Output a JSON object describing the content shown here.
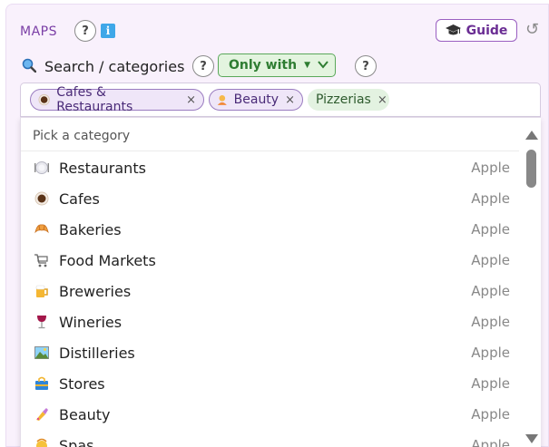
{
  "header": {
    "title": "MAPS",
    "help_label": "?",
    "info_label": "i",
    "guide_label": "Guide"
  },
  "search": {
    "label": "Search / categories",
    "help_label": "?",
    "mode_label": "Only with",
    "help2_label": "?"
  },
  "selected_tags": [
    {
      "label": "Cafes & Restaurants",
      "icon": "coffee-icon",
      "style": "purple"
    },
    {
      "label": "Beauty",
      "icon": "person-icon",
      "style": "purple"
    },
    {
      "label": "Pizzerias",
      "icon": "",
      "style": "green"
    }
  ],
  "dropdown": {
    "header": "Pick a category",
    "items": [
      {
        "label": "Restaurants",
        "source": "Apple",
        "icon": "plate-icon"
      },
      {
        "label": "Cafes",
        "source": "Apple",
        "icon": "coffee-icon"
      },
      {
        "label": "Bakeries",
        "source": "Apple",
        "icon": "croissant-icon"
      },
      {
        "label": "Food Markets",
        "source": "Apple",
        "icon": "cart-icon"
      },
      {
        "label": "Breweries",
        "source": "Apple",
        "icon": "beer-icon"
      },
      {
        "label": "Wineries",
        "source": "Apple",
        "icon": "wine-icon"
      },
      {
        "label": "Distilleries",
        "source": "Apple",
        "icon": "picture-icon"
      },
      {
        "label": "Stores",
        "source": "Apple",
        "icon": "shopping-bag-icon"
      },
      {
        "label": "Beauty",
        "source": "Apple",
        "icon": "nail-polish-icon"
      },
      {
        "label": "Spas",
        "source": "Apple",
        "icon": "spa-icon"
      }
    ]
  },
  "tag_remove_label": "×",
  "colors": {
    "accent": "#7b3fa6",
    "panel_bg": "#f9f1fc",
    "only_with_bg": "#e3f4df",
    "only_with_border": "#5aa85a"
  }
}
